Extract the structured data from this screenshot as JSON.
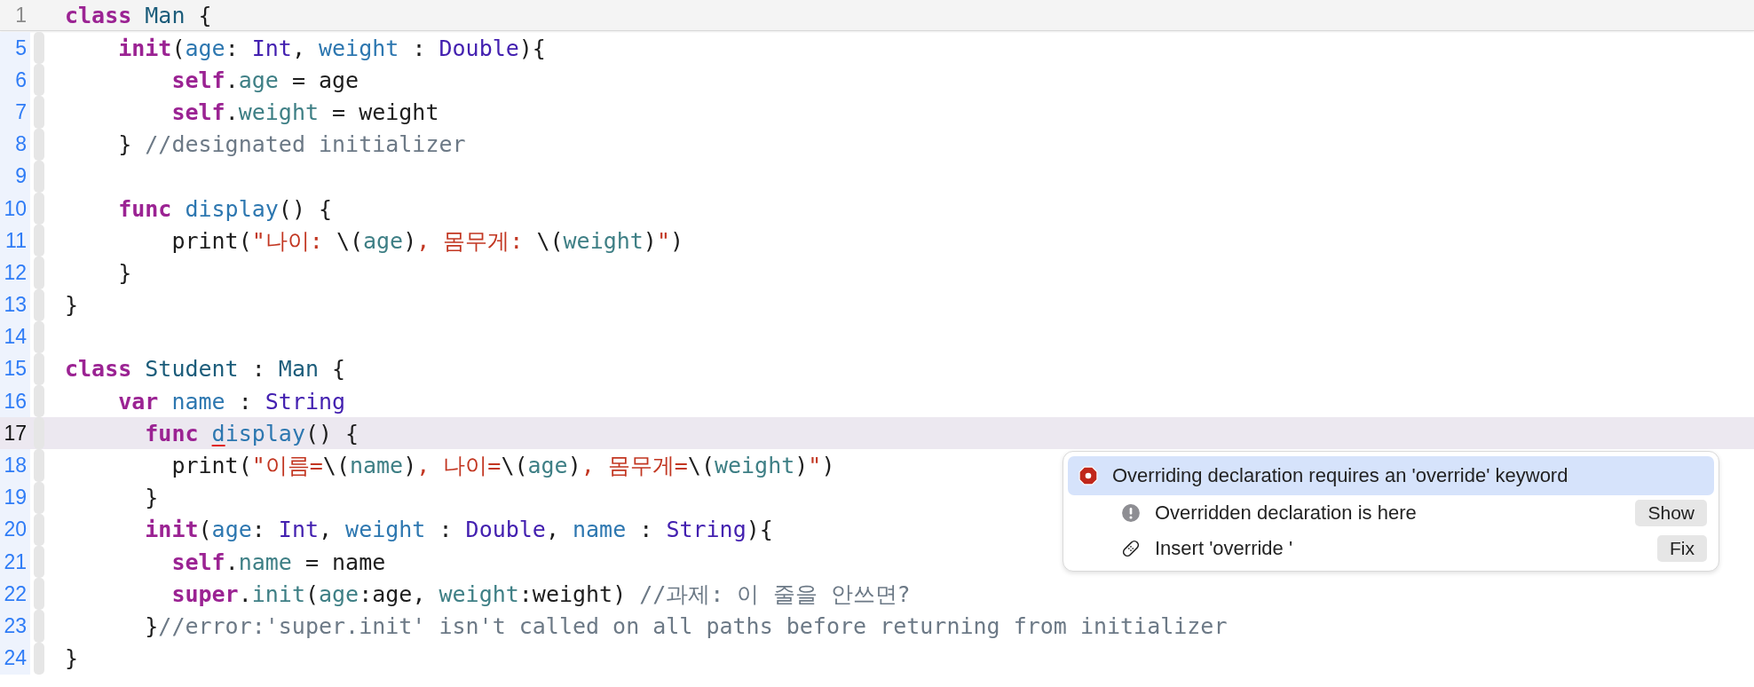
{
  "sticky_header": {
    "number": "1",
    "tokens": [
      {
        "kind": "keyword",
        "text": "class "
      },
      {
        "kind": "class",
        "text": "Man"
      },
      {
        "kind": "plain",
        "text": " {"
      }
    ]
  },
  "lines": [
    {
      "number": "5",
      "current": false,
      "tokens": [
        {
          "kind": "keyword",
          "text": "    init"
        },
        {
          "kind": "plain",
          "text": "("
        },
        {
          "kind": "declaration",
          "text": "age"
        },
        {
          "kind": "plain",
          "text": ": "
        },
        {
          "kind": "type",
          "text": "Int"
        },
        {
          "kind": "plain",
          "text": ", "
        },
        {
          "kind": "declaration",
          "text": "weight"
        },
        {
          "kind": "plain",
          "text": " : "
        },
        {
          "kind": "type",
          "text": "Double"
        },
        {
          "kind": "plain",
          "text": "){"
        }
      ]
    },
    {
      "number": "6",
      "current": false,
      "tokens": [
        {
          "kind": "keyword",
          "text": "        self"
        },
        {
          "kind": "plain",
          "text": "."
        },
        {
          "kind": "property",
          "text": "age"
        },
        {
          "kind": "plain",
          "text": " = age"
        }
      ]
    },
    {
      "number": "7",
      "current": false,
      "tokens": [
        {
          "kind": "keyword",
          "text": "        self"
        },
        {
          "kind": "plain",
          "text": "."
        },
        {
          "kind": "property",
          "text": "weight"
        },
        {
          "kind": "plain",
          "text": " = weight"
        }
      ]
    },
    {
      "number": "8",
      "current": false,
      "tokens": [
        {
          "kind": "plain",
          "text": "    } "
        },
        {
          "kind": "comment",
          "text": "//designated initializer"
        }
      ]
    },
    {
      "number": "9",
      "current": false
    },
    {
      "number": "10",
      "current": false,
      "tokens": [
        {
          "kind": "keyword",
          "text": "    func "
        },
        {
          "kind": "declaration",
          "text": "display"
        },
        {
          "kind": "plain",
          "text": "() {"
        }
      ]
    },
    {
      "number": "11",
      "current": false,
      "tokens": [
        {
          "kind": "plain",
          "text": "        print("
        },
        {
          "kind": "string",
          "text": "\"나이: "
        },
        {
          "kind": "plain",
          "text": "\\("
        },
        {
          "kind": "property",
          "text": "age"
        },
        {
          "kind": "plain",
          "text": ")"
        },
        {
          "kind": "string",
          "text": ", 몸무게: "
        },
        {
          "kind": "plain",
          "text": "\\("
        },
        {
          "kind": "property",
          "text": "weight"
        },
        {
          "kind": "plain",
          "text": ")"
        },
        {
          "kind": "string",
          "text": "\""
        },
        {
          "kind": "plain",
          "text": ")"
        }
      ]
    },
    {
      "number": "12",
      "current": false,
      "tokens": [
        {
          "kind": "plain",
          "text": "    }"
        }
      ]
    },
    {
      "number": "13",
      "current": false,
      "tokens": [
        {
          "kind": "plain",
          "text": "}"
        }
      ]
    },
    {
      "number": "14",
      "current": false
    },
    {
      "number": "15",
      "current": false,
      "tokens": [
        {
          "kind": "keyword",
          "text": "class "
        },
        {
          "kind": "class",
          "text": "Student"
        },
        {
          "kind": "plain",
          "text": " : "
        },
        {
          "kind": "class",
          "text": "Man"
        },
        {
          "kind": "plain",
          "text": " {"
        }
      ]
    },
    {
      "number": "16",
      "current": false,
      "tokens": [
        {
          "kind": "keyword",
          "text": "    var "
        },
        {
          "kind": "declaration",
          "text": "name"
        },
        {
          "kind": "plain",
          "text": " : "
        },
        {
          "kind": "type",
          "text": "String"
        }
      ]
    },
    {
      "number": "17",
      "current": true,
      "tokens": [
        {
          "kind": "keyword",
          "text": "      func "
        },
        {
          "kind": "error",
          "text": "d"
        },
        {
          "kind": "declaration",
          "text": "isplay"
        },
        {
          "kind": "plain",
          "text": "() {"
        }
      ]
    },
    {
      "number": "18",
      "current": false,
      "tokens": [
        {
          "kind": "plain",
          "text": "        print("
        },
        {
          "kind": "string",
          "text": "\"이름="
        },
        {
          "kind": "plain",
          "text": "\\("
        },
        {
          "kind": "property",
          "text": "name"
        },
        {
          "kind": "plain",
          "text": ")"
        },
        {
          "kind": "string",
          "text": ", 나이="
        },
        {
          "kind": "plain",
          "text": "\\("
        },
        {
          "kind": "property",
          "text": "age"
        },
        {
          "kind": "plain",
          "text": ")"
        },
        {
          "kind": "string",
          "text": ", 몸무게="
        },
        {
          "kind": "plain",
          "text": "\\("
        },
        {
          "kind": "property",
          "text": "weight"
        },
        {
          "kind": "plain",
          "text": ")"
        },
        {
          "kind": "string",
          "text": "\""
        },
        {
          "kind": "plain",
          "text": ")"
        }
      ]
    },
    {
      "number": "19",
      "current": false,
      "tokens": [
        {
          "kind": "plain",
          "text": "      }"
        }
      ]
    },
    {
      "number": "20",
      "current": false,
      "tokens": [
        {
          "kind": "keyword",
          "text": "      init"
        },
        {
          "kind": "plain",
          "text": "("
        },
        {
          "kind": "declaration",
          "text": "age"
        },
        {
          "kind": "plain",
          "text": ": "
        },
        {
          "kind": "type",
          "text": "Int"
        },
        {
          "kind": "plain",
          "text": ", "
        },
        {
          "kind": "declaration",
          "text": "weight"
        },
        {
          "kind": "plain",
          "text": " : "
        },
        {
          "kind": "type",
          "text": "Double"
        },
        {
          "kind": "plain",
          "text": ", "
        },
        {
          "kind": "declaration",
          "text": "name"
        },
        {
          "kind": "plain",
          "text": " : "
        },
        {
          "kind": "type",
          "text": "String"
        },
        {
          "kind": "plain",
          "text": "){"
        }
      ]
    },
    {
      "number": "21",
      "current": false,
      "tokens": [
        {
          "kind": "keyword",
          "text": "        self"
        },
        {
          "kind": "plain",
          "text": "."
        },
        {
          "kind": "property",
          "text": "name"
        },
        {
          "kind": "plain",
          "text": " = name"
        }
      ]
    },
    {
      "number": "22",
      "current": false,
      "tokens": [
        {
          "kind": "keyword",
          "text": "        super"
        },
        {
          "kind": "plain",
          "text": "."
        },
        {
          "kind": "property",
          "text": "init"
        },
        {
          "kind": "plain",
          "text": "("
        },
        {
          "kind": "property",
          "text": "age"
        },
        {
          "kind": "plain",
          "text": ":age, "
        },
        {
          "kind": "property",
          "text": "weight"
        },
        {
          "kind": "plain",
          "text": ":weight) "
        },
        {
          "kind": "comment",
          "text": "//과제: 이 줄을 안쓰면?"
        }
      ]
    },
    {
      "number": "23",
      "current": false,
      "tokens": [
        {
          "kind": "plain",
          "text": "      }"
        },
        {
          "kind": "comment",
          "text": "//error:'super.init' isn't called on all paths before returning from initializer"
        }
      ]
    },
    {
      "number": "24",
      "current": false,
      "tokens": [
        {
          "kind": "plain",
          "text": "}"
        }
      ]
    }
  ],
  "issue_popup": {
    "items": [
      {
        "kind": "error",
        "text": "Overriding declaration requires an 'override' keyword",
        "selected": true
      },
      {
        "kind": "note",
        "text": "Overridden declaration is here",
        "selected": false,
        "button": "Show"
      },
      {
        "kind": "fixit",
        "text": "Insert 'override '",
        "selected": false,
        "button": "Fix"
      }
    ]
  }
}
